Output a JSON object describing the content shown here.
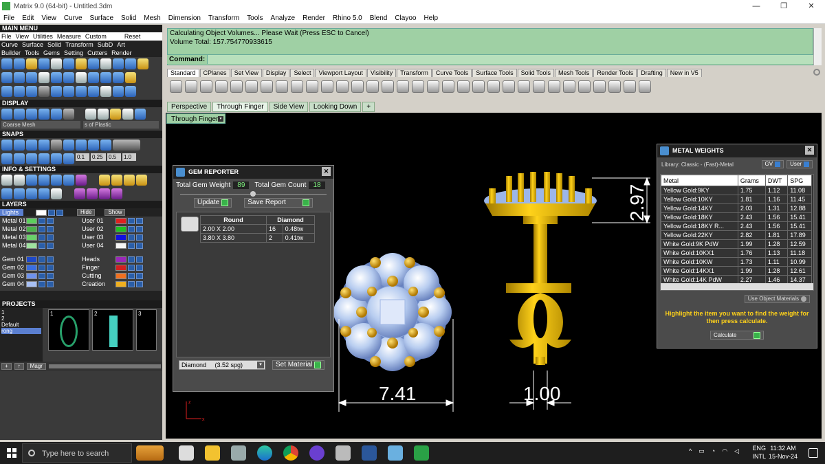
{
  "window": {
    "title": "Matrix 9.0 (64-bit) - Untitled.3dm",
    "minimize": "—",
    "restore": "❐",
    "close": "✕"
  },
  "menu": [
    "File",
    "Edit",
    "View",
    "Curve",
    "Surface",
    "Solid",
    "Mesh",
    "Dimension",
    "Transform",
    "Tools",
    "Analyze",
    "Render",
    "Rhino 5.0",
    "Blend",
    "Clayoo",
    "Help"
  ],
  "left": {
    "main_menu": "MAIN MENU",
    "mm_row1": [
      "File",
      "View",
      "Utilities",
      "Measure",
      "Custom",
      "Reset"
    ],
    "mm_row2": [
      "Curve",
      "Surface",
      "Solid",
      "Transform",
      "SubD",
      "Art"
    ],
    "mm_row3": [
      "Builder",
      "Tools",
      "Gems",
      "Setting",
      "Cutters",
      "Render"
    ],
    "display": "DISPLAY",
    "display_sel1": "Coarse Mesh",
    "display_sel2": "s of Plastic",
    "snaps": "SNAPS",
    "snap_vals": [
      "0.1",
      "0.25",
      "0.5",
      "1.0"
    ],
    "info": "INFO & SETTINGS",
    "layers": "LAYERS",
    "lights": "Lights",
    "hide": "Hide",
    "show": "Show",
    "layers_left": [
      "Metal 01",
      "Metal 02",
      "Metal 03",
      "Metal 04",
      "Gem 01",
      "Gem 02",
      "Gem 03",
      "Gem 04"
    ],
    "layers_right": [
      "User 01",
      "User 02",
      "User 03",
      "User 04",
      "Heads",
      "Finger",
      "Cutting",
      "Creation"
    ],
    "projects": "PROJECTS",
    "proj_items": [
      "1",
      "2",
      "Default",
      "rong"
    ],
    "proj_thumbs": [
      "1",
      "2",
      "3"
    ],
    "magr": "Magr"
  },
  "cmd": {
    "line1": "Calculating Object Volumes... Please Wait (Press ESC to Cancel)",
    "line2": "Volume Total: 157.754770933615",
    "label": "Command:"
  },
  "toolbar_tabs": [
    "Standard",
    "CPlanes",
    "Set View",
    "Display",
    "Select",
    "Viewport Layout",
    "Visibility",
    "Transform",
    "Curve Tools",
    "Surface Tools",
    "Solid Tools",
    "Mesh Tools",
    "Render Tools",
    "Drafting",
    "New in V5"
  ],
  "viewport_tabs": [
    "Perspective",
    "Through Finger",
    "Side View",
    "Looking Down",
    "+"
  ],
  "viewport_label": "Through Finger",
  "gem": {
    "title": "GEM REPORTER",
    "tgw_label": "Total Gem Weight",
    "tgw": "89",
    "tgc_label": "Total Gem Count",
    "tgc": "18",
    "update": "Update",
    "save": "Save Report",
    "headers": [
      "Round",
      "Diamond"
    ],
    "rows": [
      [
        "2.00 X 2.00",
        "16",
        "0.48tw"
      ],
      [
        "3.80 X 3.80",
        "2",
        "0.41tw"
      ]
    ],
    "material": "Diamond     (3.52 spg)",
    "set_material": "Set Material"
  },
  "dims": {
    "d1": "7.41",
    "d2": "1.00",
    "d3": "2.97"
  },
  "metal": {
    "title": "METAL WEIGHTS",
    "library": "Library: Classic - (Fast)-Metal",
    "gv": "GV",
    "user": "User",
    "headers": [
      "Metal",
      "Grams",
      "DWT",
      "SPG"
    ],
    "rows": [
      [
        "Yellow Gold:9KY",
        "1.75",
        "1.12",
        "11.08"
      ],
      [
        "Yellow Gold:10KY",
        "1.81",
        "1.16",
        "11.45"
      ],
      [
        "Yellow Gold:14KY",
        "2.03",
        "1.31",
        "12.88"
      ],
      [
        "Yellow Gold:18KY",
        "2.43",
        "1.56",
        "15.41"
      ],
      [
        "Yellow Gold:18KY R...",
        "2.43",
        "1.56",
        "15.41"
      ],
      [
        "Yellow Gold:22KY",
        "2.82",
        "1.81",
        "17.89"
      ],
      [
        "White Gold:9K PdW",
        "1.99",
        "1.28",
        "12.59"
      ],
      [
        "White Gold:10KX1",
        "1.76",
        "1.13",
        "11.18"
      ],
      [
        "White Gold:10KW",
        "1.73",
        "1.11",
        "10.99"
      ],
      [
        "White Gold:14KX1",
        "1.99",
        "1.28",
        "12.61"
      ],
      [
        "White Gold:14K PdW",
        "2.27",
        "1.46",
        "14.37"
      ]
    ],
    "use_obj": "Use Object Materials",
    "hint": "Highlight the item you want to find the weight for then press calculate.",
    "calculate": "Calculate"
  },
  "taskbar": {
    "search": "Type here to search",
    "lang1": "ENG",
    "lang2": "INTL",
    "time": "11:32 AM",
    "date": "15-Nov-24"
  }
}
